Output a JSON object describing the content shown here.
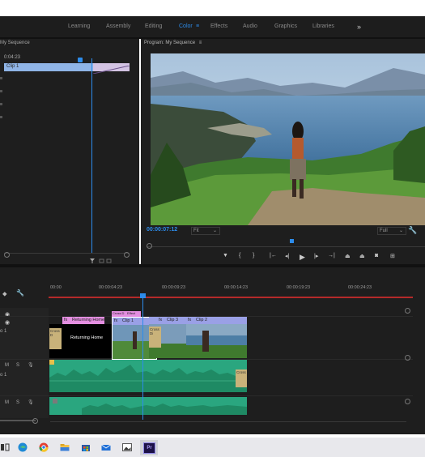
{
  "workspace_tabs": [
    {
      "label": "Learning",
      "active": false
    },
    {
      "label": "Assembly",
      "active": false
    },
    {
      "label": "Editing",
      "active": false
    },
    {
      "label": "Color",
      "active": true
    },
    {
      "label": "Effects",
      "active": false
    },
    {
      "label": "Audio",
      "active": false
    },
    {
      "label": "Graphics",
      "active": false
    },
    {
      "label": "Libraries",
      "active": false
    }
  ],
  "workspace_menu_glyph": "≡",
  "overflow_glyph": "»",
  "source": {
    "title": "My Sequence",
    "timecode": "0:04:23",
    "clip_label": "Clip 1"
  },
  "program": {
    "title": "Program: My Sequence",
    "menu_glyph": "≡",
    "timecode": "00:00:07:12",
    "fit": "Fit",
    "quality": "Full"
  },
  "timeline": {
    "ruler_labels": [
      "00:00",
      "00:00:04:23",
      "00:00:09:23",
      "00:00:14:23",
      "00:00:19:23",
      "00:00:24:23"
    ],
    "track_v1_name": "o 1",
    "track_a1_name": "o 1",
    "track_labels": {
      "m": "M",
      "s": "S"
    },
    "clips": {
      "returning_home_top": "Returning Home",
      "returning_home_main": "Returning Home",
      "cross_dissolve_1": "Cross D",
      "cross_dissolve_2": "Cross Di",
      "cross_dissolve_3": "Cross",
      "clip1": "Clip 1",
      "clip3": "Clip 3",
      "clip2": "Clip 2",
      "fx": "fx",
      "small_tags": [
        "Cross D",
        "Effect"
      ]
    }
  },
  "colors": {
    "accent": "#2d8ceb",
    "panel_bg": "#1e1e1e",
    "audio_clip": "#2aa67f",
    "title_clip": "#e38ee0",
    "video_clip": "#9aa0e6"
  },
  "taskbar_icons": [
    "task-view-icon",
    "edge-icon",
    "chrome-icon",
    "file-explorer-icon",
    "store-icon",
    "mail-icon",
    "photos-icon",
    "premiere-pro-icon"
  ]
}
